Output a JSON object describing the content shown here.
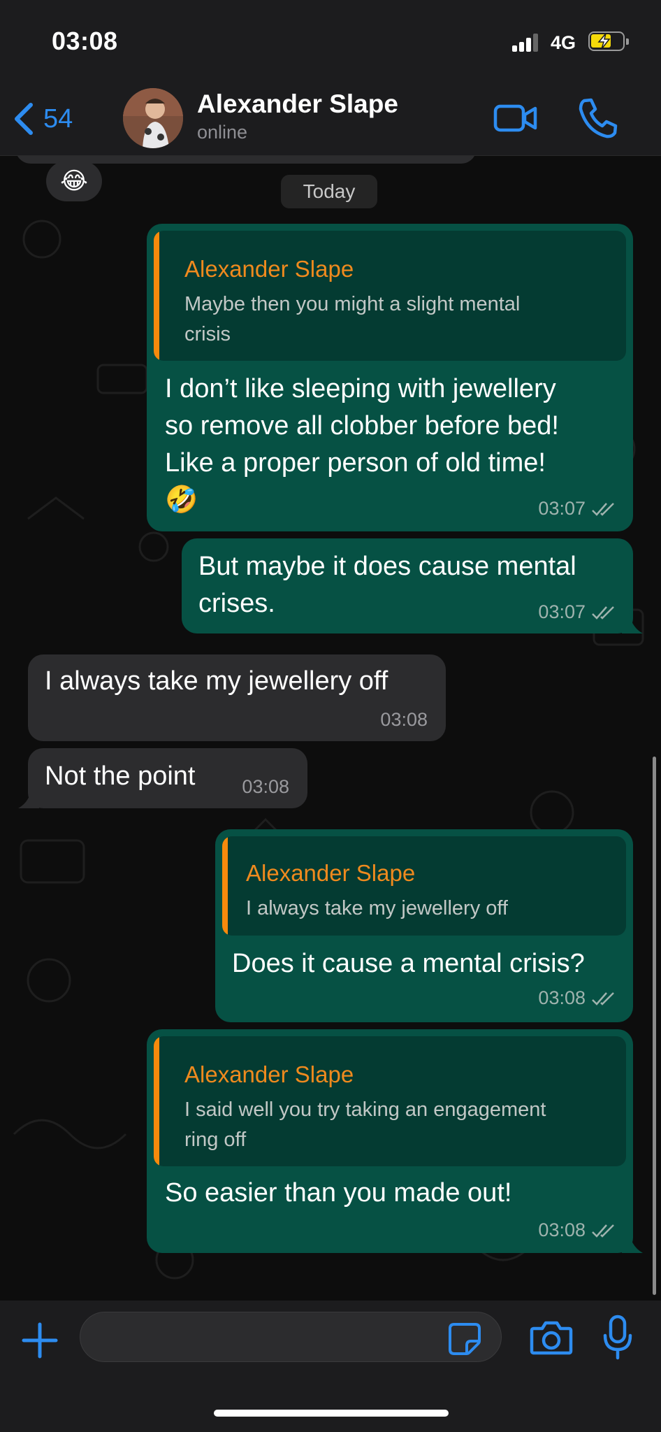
{
  "status_bar": {
    "time": "03:08",
    "network": "4G"
  },
  "header": {
    "back_count": "54",
    "contact_name": "Alexander Slape",
    "contact_status": "online"
  },
  "chat": {
    "reaction_emoji": "😂",
    "date_label": "Today",
    "messages": [
      {
        "direction": "out",
        "quote_name": "Alexander Slape",
        "quote_text_1": "Maybe then you might a slight mental",
        "quote_text_2": "crisis",
        "line_1": "I don’t like sleeping with jewellery",
        "line_2": "so remove all clobber before bed!",
        "line_3": "Like a proper person of old time!",
        "emoji": "🤣",
        "time": "03:07"
      },
      {
        "direction": "out",
        "line_1": "But maybe it does cause mental",
        "line_2": "crises.",
        "time": "03:07"
      },
      {
        "direction": "in",
        "text": "I always take my jewellery off",
        "time": "03:08"
      },
      {
        "direction": "in",
        "text": "Not the point",
        "time": "03:08"
      },
      {
        "direction": "out",
        "quote_name": "Alexander Slape",
        "quote_text": "I always take my jewellery off",
        "text": "Does it cause a mental crisis?",
        "time": "03:08"
      },
      {
        "direction": "out",
        "quote_name": "Alexander Slape",
        "quote_text_1": "I said well you try taking an engagement",
        "quote_text_2": "ring off",
        "text": "So easier than you made out!",
        "time": "03:08"
      }
    ]
  },
  "colors": {
    "outgoing_bubble": "#065144",
    "incoming_bubble": "#2c2c2e",
    "quote_accent": "#f78a0c",
    "ios_blue": "#2d8cf0"
  },
  "icons": [
    "back-chevron-icon",
    "video-call-icon",
    "phone-icon",
    "plus-icon",
    "sticker-icon",
    "camera-icon",
    "microphone-icon",
    "read-ticks-icon"
  ]
}
